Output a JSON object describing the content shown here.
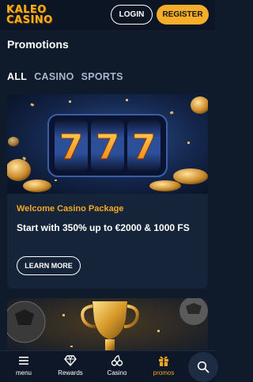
{
  "header": {
    "logo_line1": "KALEO",
    "logo_line2": "CASINO",
    "login_label": "LOGIN",
    "register_label": "REGISTER"
  },
  "page": {
    "title": "Promotions"
  },
  "filters": [
    {
      "label": "ALL",
      "active": true
    },
    {
      "label": "CASINO",
      "active": false
    },
    {
      "label": "SPORTS",
      "active": false
    }
  ],
  "promo_card": {
    "reel_digits": [
      "7",
      "7",
      "7"
    ],
    "tag": "Welcome Casino Package",
    "description": "Start with 350% up to €2000 & 1000 FS",
    "button_label": "LEARN MORE"
  },
  "bottom_nav": {
    "items": [
      {
        "label": "menu",
        "icon": "menu-icon",
        "active": false
      },
      {
        "label": "Rewards",
        "icon": "diamond-icon",
        "active": false
      },
      {
        "label": "Casino",
        "icon": "cherries-icon",
        "active": false
      },
      {
        "label": "promos",
        "icon": "gift-icon",
        "active": true
      }
    ],
    "search_icon": "search-icon"
  },
  "colors": {
    "accent": "#f5ad2a",
    "background": "#0f1a2b",
    "card": "#16243a",
    "active_tab": "#f5a623"
  }
}
